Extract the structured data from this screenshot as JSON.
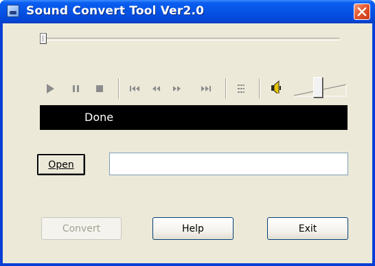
{
  "window": {
    "title": "Sound Convert Tool Ver2.0"
  },
  "player": {
    "controls": [
      "play-icon",
      "pause-icon",
      "stop-icon",
      "skip-back-icon",
      "rewind-icon",
      "fast-forward-icon",
      "skip-forward-icon",
      "playlist-icon",
      "speaker-icon"
    ],
    "seek_position": 0.0,
    "volume_level": 0.45,
    "status": "Done"
  },
  "file": {
    "open_label": "Open",
    "path_value": "",
    "path_placeholder": ""
  },
  "actions": {
    "convert_label": "Convert",
    "help_label": "Help",
    "exit_label": "Exit"
  },
  "colors": {
    "titlebar": "#0553e4",
    "client_bg": "#ece9d8",
    "status_bg": "#000000",
    "status_text": "#ffffff",
    "close_button": "#e3582e"
  }
}
